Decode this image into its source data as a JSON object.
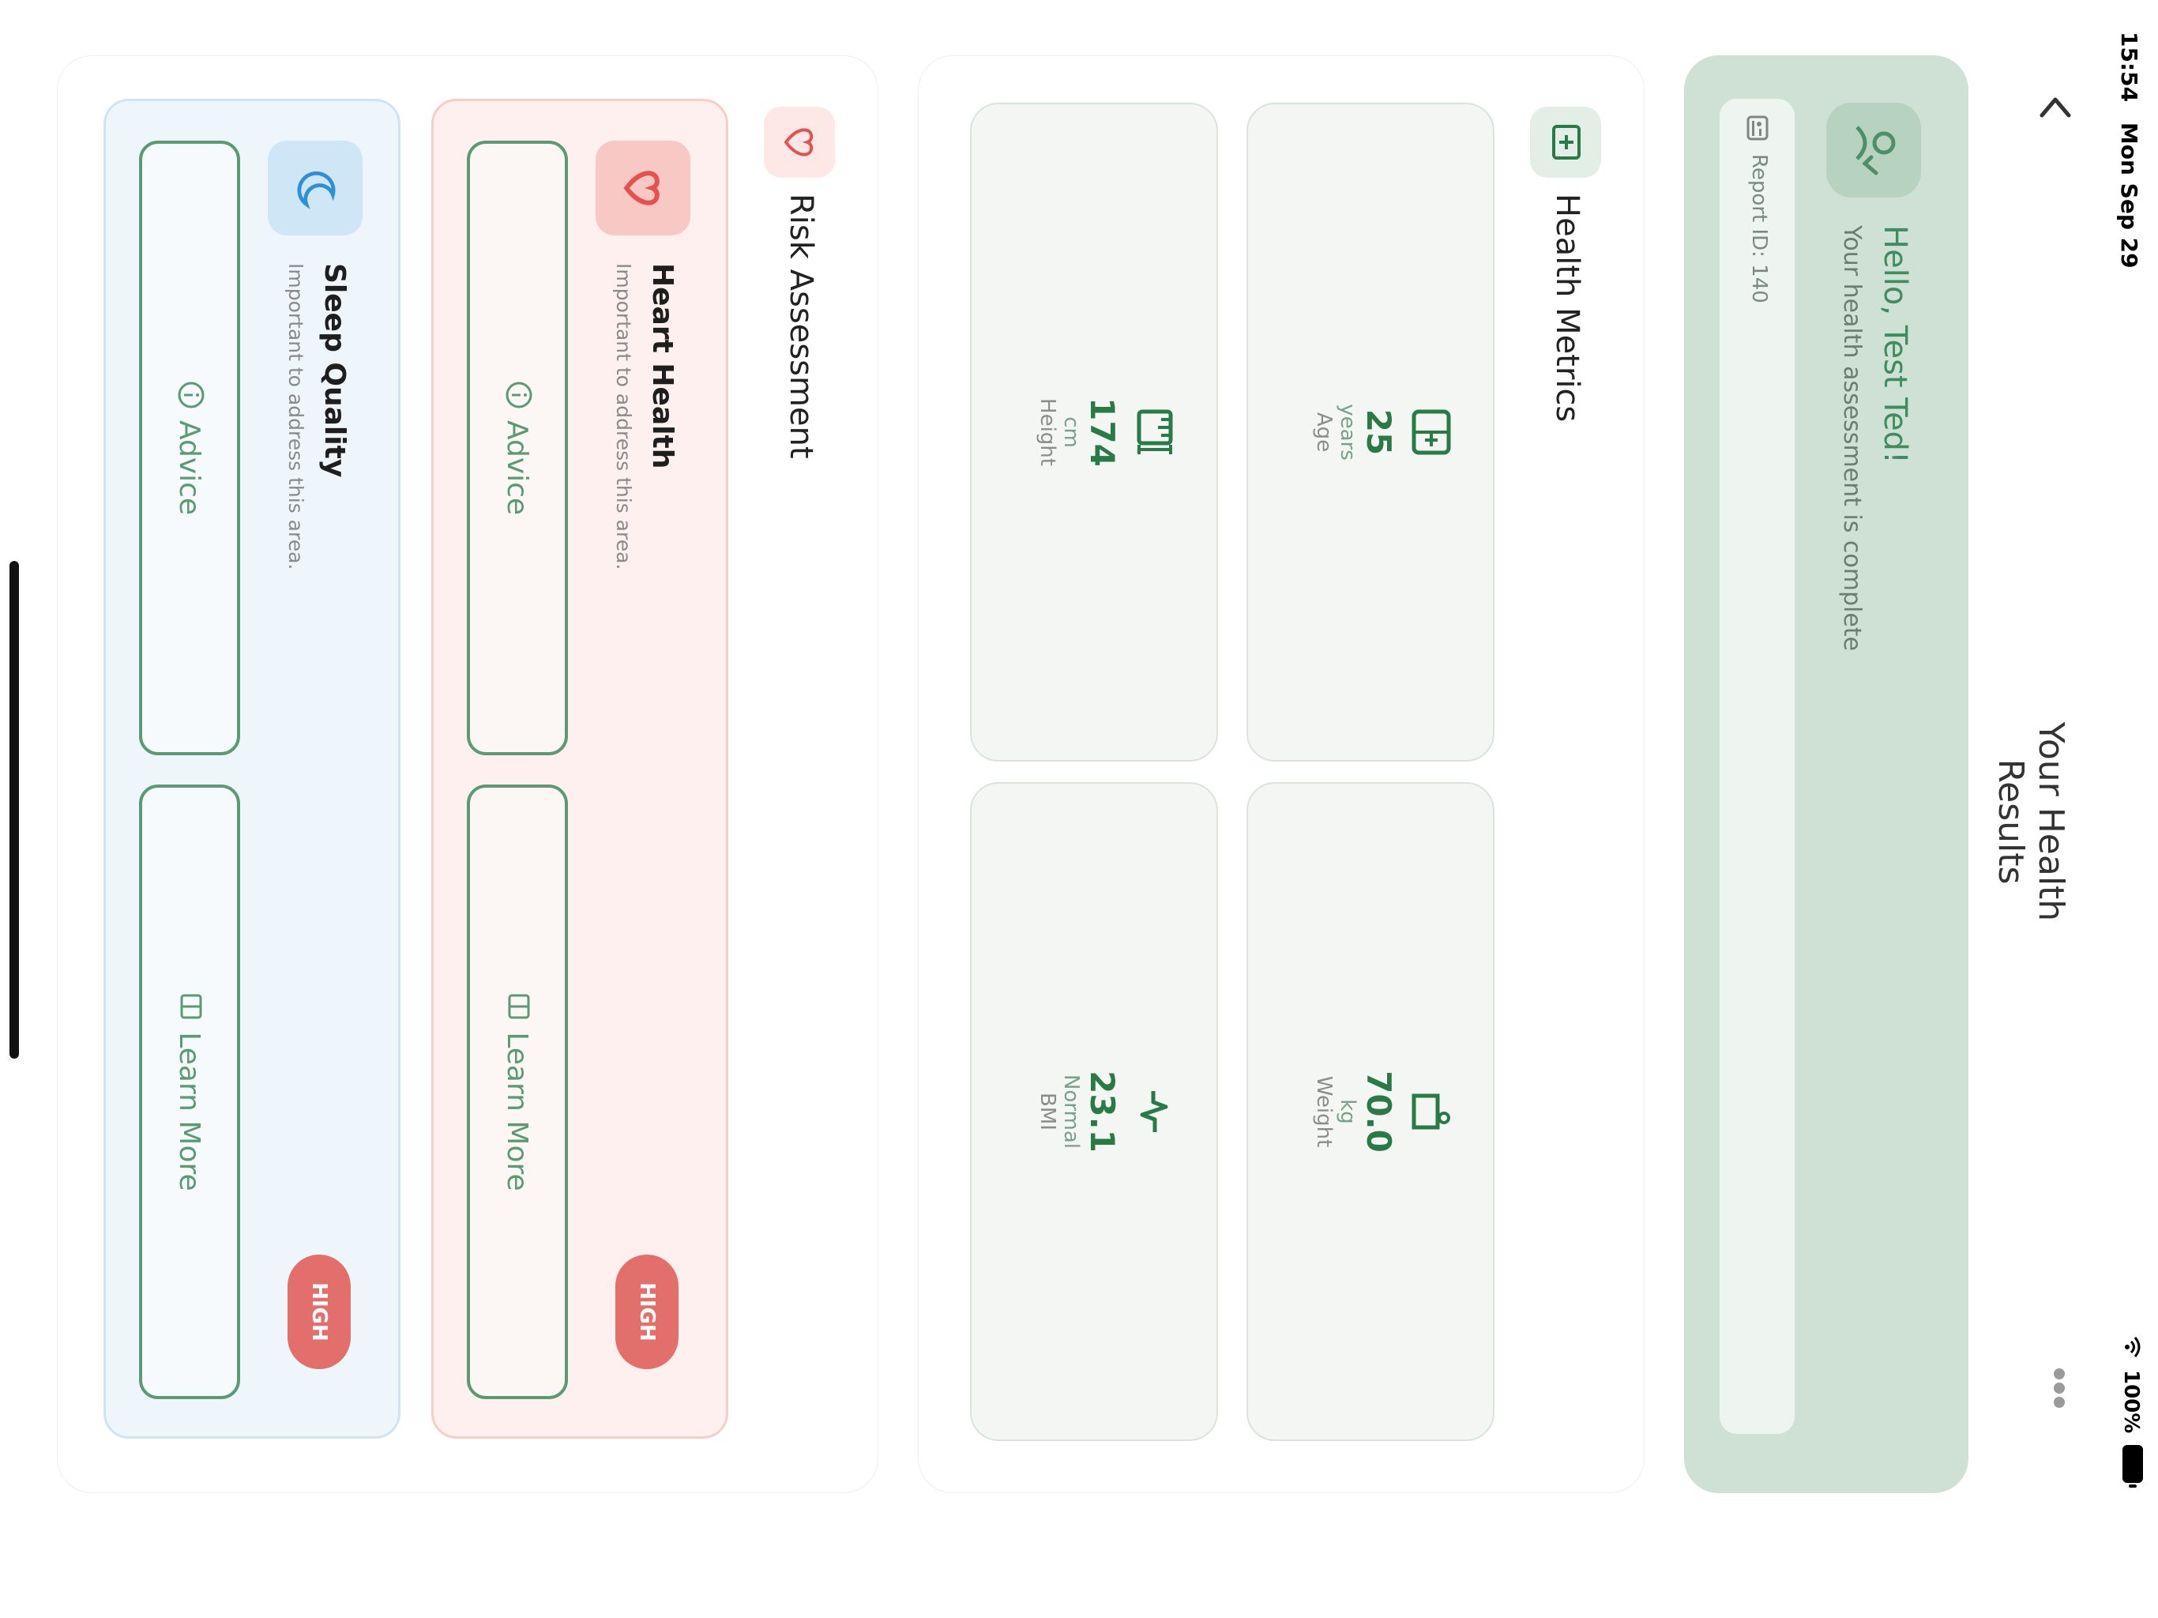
{
  "status_bar": {
    "time": "15:54",
    "date": "Mon Sep 29",
    "battery": "100%"
  },
  "nav": {
    "title": "Your Health Results",
    "back_icon": "chevron-up-icon",
    "more_icon": "more-dots-icon"
  },
  "greeting": {
    "title": "Hello, Test Ted!",
    "subtitle": "Your health assessment is complete",
    "report": "Report ID: 140"
  },
  "metrics": {
    "title": "Health Metrics",
    "items": [
      {
        "value": "25",
        "unit": "years",
        "label": "Age"
      },
      {
        "value": "70.0",
        "unit": "kg",
        "label": "Weight"
      },
      {
        "value": "174",
        "unit": "cm",
        "label": "Height"
      },
      {
        "value": "23.1",
        "unit": "Normal",
        "label": "BMI"
      }
    ]
  },
  "risk": {
    "title": "Risk Assessment",
    "items": [
      {
        "title": "Heart Health",
        "subtitle": "Important to address this area.",
        "badge": "HIGH",
        "advice": "Advice",
        "learn": "Learn More"
      },
      {
        "title": "Sleep Quality",
        "subtitle": "Important to address this area.",
        "badge": "HIGH",
        "advice": "Advice",
        "learn": "Learn More"
      }
    ]
  },
  "colors": {
    "accent": "#2a7a48",
    "high": "#e26f6b",
    "heart": "#e5524e",
    "sleep": "#2f8fd6"
  }
}
